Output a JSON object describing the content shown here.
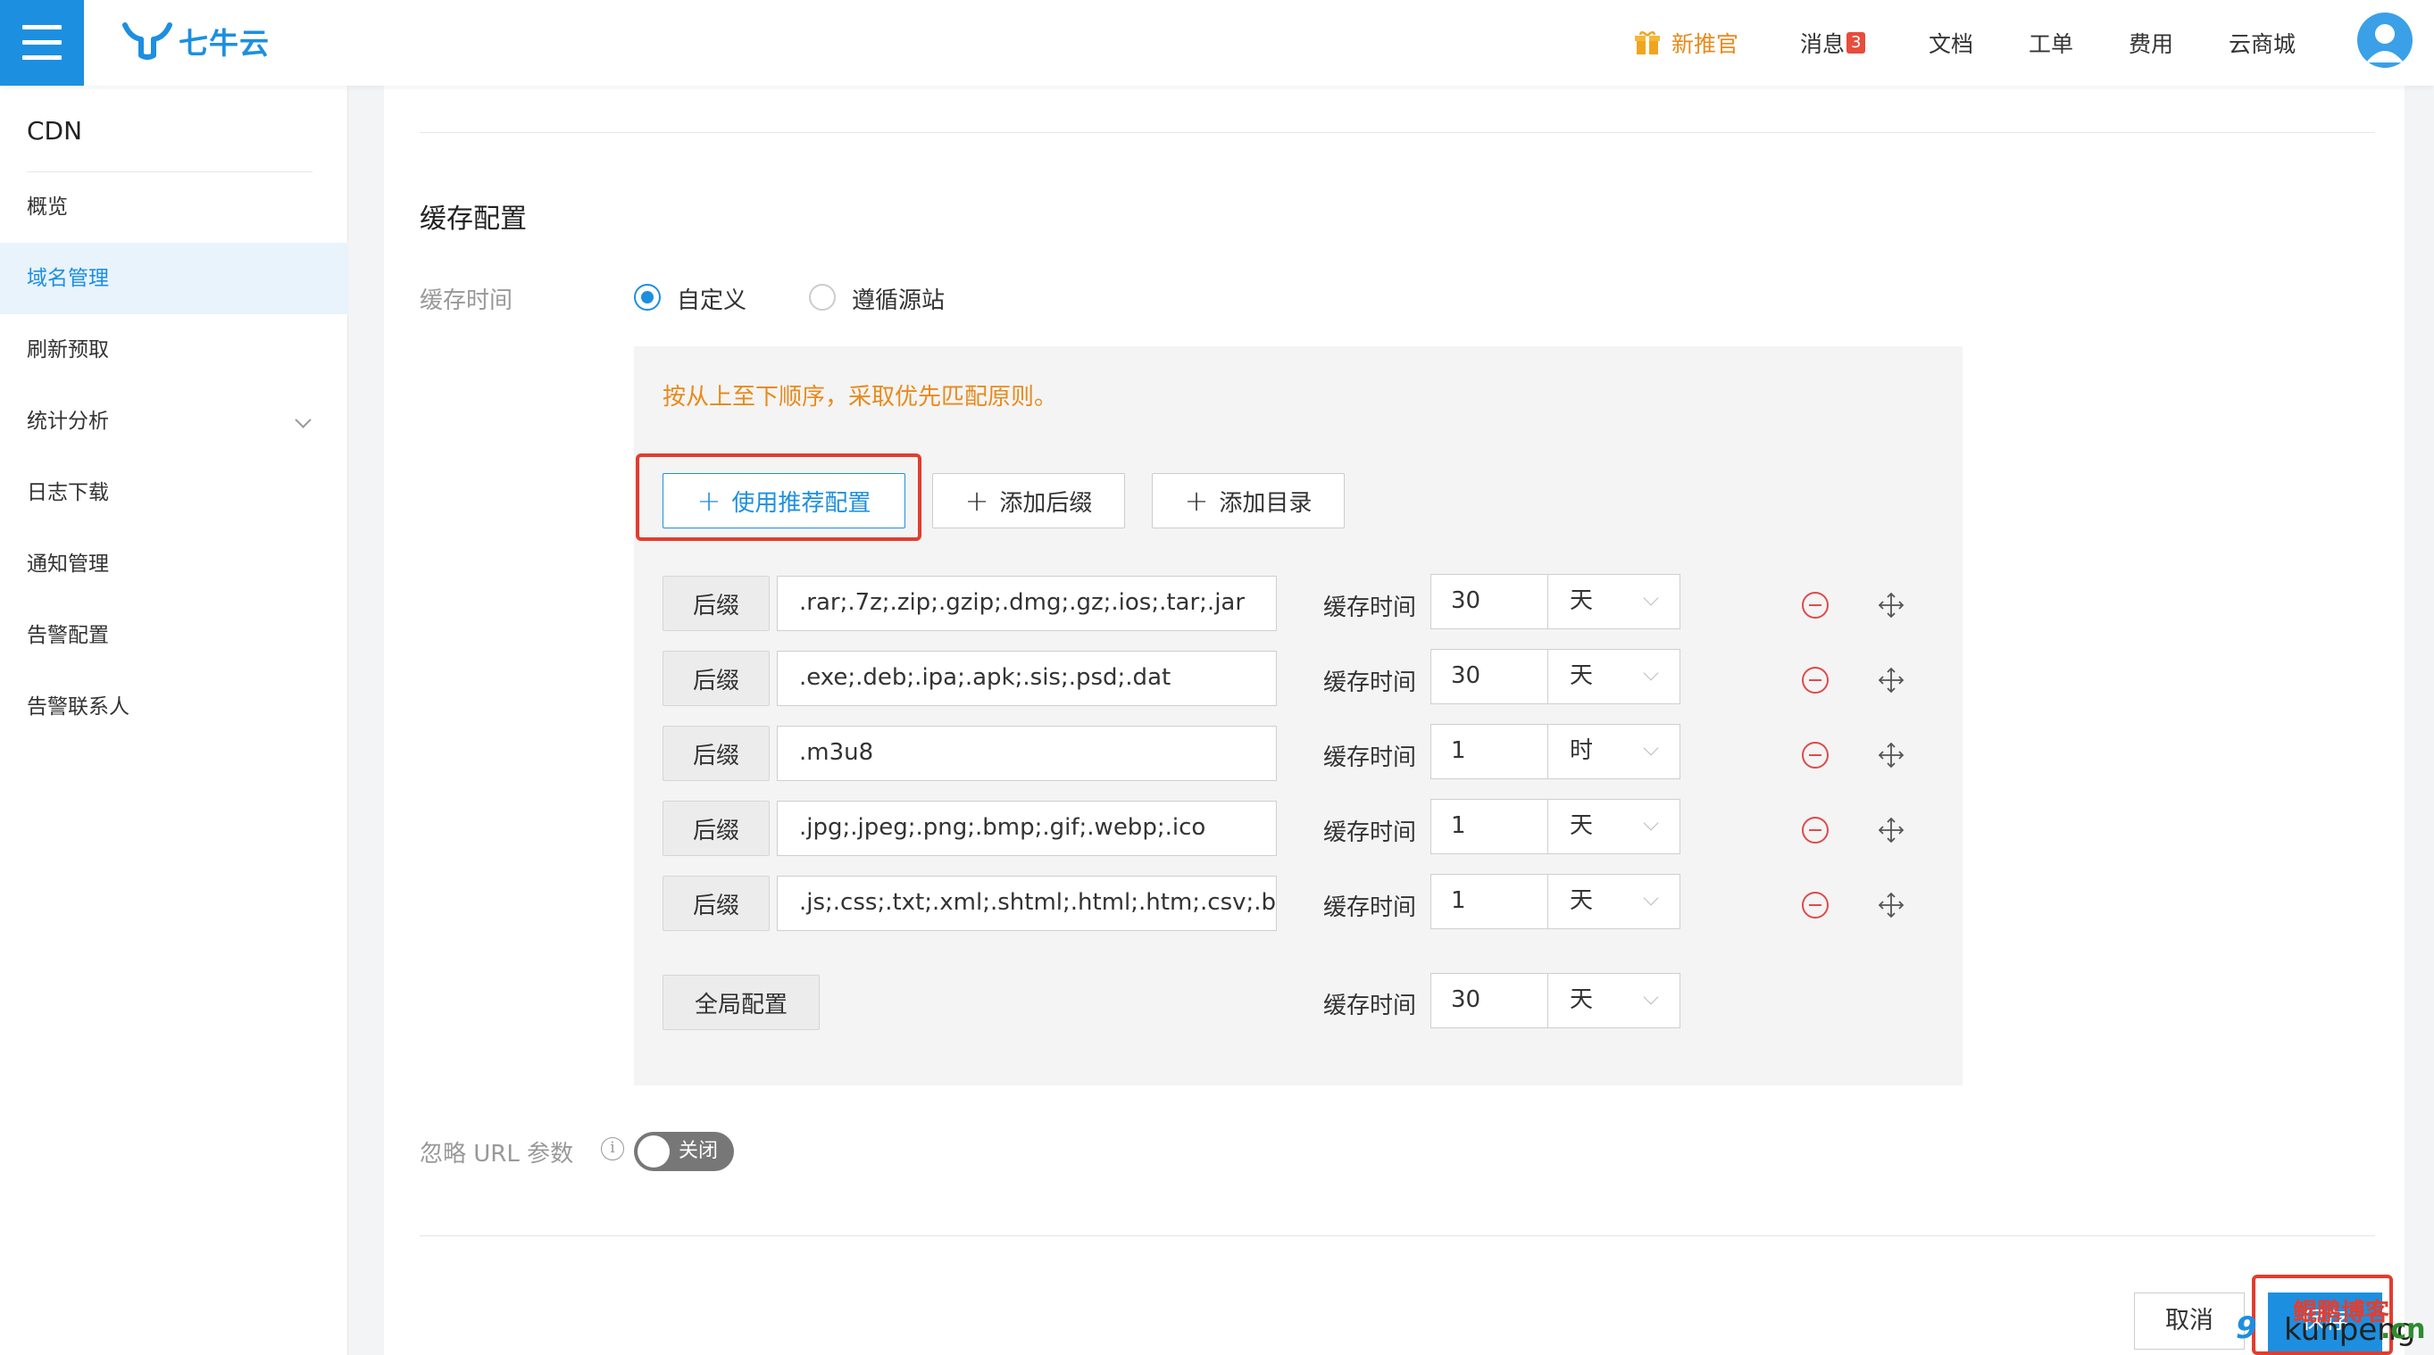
{
  "header": {
    "logo_text": "七牛云",
    "nav": [
      {
        "label": "新推官",
        "accent": true
      },
      {
        "label": "消息",
        "badge": "3"
      },
      {
        "label": "文档"
      },
      {
        "label": "工单"
      },
      {
        "label": "费用"
      },
      {
        "label": "云商城"
      }
    ]
  },
  "sidebar": {
    "title": "CDN",
    "items": [
      {
        "label": "概览"
      },
      {
        "label": "域名管理",
        "active": true
      },
      {
        "label": "刷新预取"
      },
      {
        "label": "统计分析",
        "expandable": true
      },
      {
        "label": "日志下载"
      },
      {
        "label": "通知管理"
      },
      {
        "label": "告警配置"
      },
      {
        "label": "告警联系人"
      }
    ]
  },
  "cache": {
    "section_title": "缓存配置",
    "time_label": "缓存时间",
    "mode_options": [
      {
        "label": "自定义",
        "checked": true
      },
      {
        "label": "遵循源站",
        "checked": false
      }
    ],
    "notice": "按从上至下顺序，采取优先匹配原则。",
    "buttons": {
      "recommend": "使用推荐配置",
      "add_suffix": "添加后缀",
      "add_dir": "添加目录"
    },
    "rules": [
      {
        "type": "后缀",
        "pattern": ".rar;.7z;.zip;.gzip;.dmg;.gz;.ios;.tar;.jar",
        "time_label": "缓存时间",
        "value": "30",
        "unit": "天"
      },
      {
        "type": "后缀",
        "pattern": ".exe;.deb;.ipa;.apk;.sis;.psd;.dat",
        "time_label": "缓存时间",
        "value": "30",
        "unit": "天"
      },
      {
        "type": "后缀",
        "pattern": ".m3u8",
        "time_label": "缓存时间",
        "value": "1",
        "unit": "时"
      },
      {
        "type": "后缀",
        "pattern": ".jpg;.jpeg;.png;.bmp;.gif;.webp;.ico",
        "time_label": "缓存时间",
        "value": "1",
        "unit": "天"
      },
      {
        "type": "后缀",
        "pattern": ".js;.css;.txt;.xml;.shtml;.html;.htm;.csv;.bat",
        "time_label": "缓存时间",
        "value": "1",
        "unit": "天"
      }
    ],
    "global": {
      "label": "全局配置",
      "time_label": "缓存时间",
      "value": "30",
      "unit": "天"
    }
  },
  "ignore_url": {
    "label": "忽略 URL 参数",
    "toggle": "关闭"
  },
  "footer": {
    "cancel": "取消",
    "save": "保存"
  },
  "watermark": {
    "line1": "鲲鹏博客",
    "prefix": "9",
    "domain": "kunpeng",
    "tld": ".cn"
  },
  "colors": {
    "primary": "#1d8fe0",
    "notice": "#e88a1c",
    "highlight": "#e33c2e",
    "danger": "#e04a4a"
  }
}
